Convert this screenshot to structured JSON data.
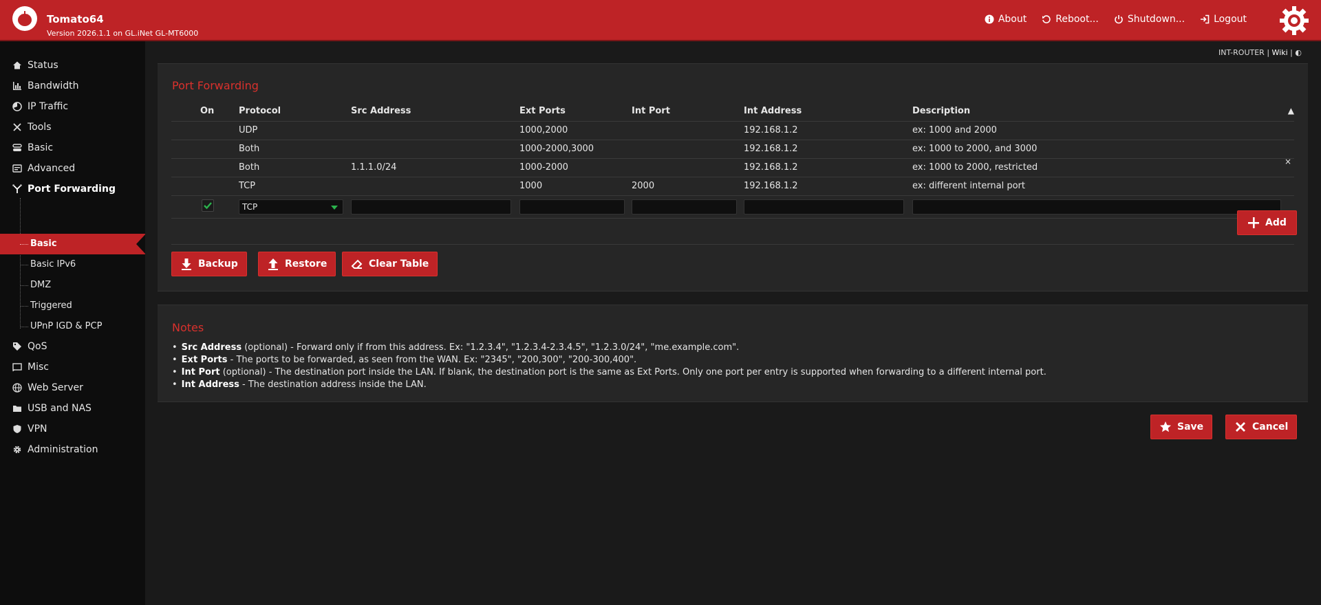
{
  "header": {
    "app_title": "Tomato64",
    "version": "Version 2026.1.1 on GL.iNet GL-MT6000",
    "nav": [
      {
        "label": "About",
        "icon": "info-icon"
      },
      {
        "label": "Reboot...",
        "icon": "reboot-icon"
      },
      {
        "label": "Shutdown...",
        "icon": "power-icon"
      },
      {
        "label": "Logout",
        "icon": "logout-icon"
      }
    ]
  },
  "sidebar": {
    "items": [
      {
        "label": "Status",
        "icon": "home-icon"
      },
      {
        "label": "Bandwidth",
        "icon": "bar-chart-icon"
      },
      {
        "label": "IP Traffic",
        "icon": "pie-icon"
      },
      {
        "label": "Tools",
        "icon": "tools-icon"
      },
      {
        "label": "Basic",
        "icon": "toggle-icon"
      },
      {
        "label": "Advanced",
        "icon": "sliders-icon"
      },
      {
        "label": "Port Forwarding",
        "icon": "fork-icon"
      },
      {
        "label": "QoS",
        "icon": "tag-icon"
      },
      {
        "label": "Misc",
        "icon": "cast-icon"
      },
      {
        "label": "Web Server",
        "icon": "globe-icon"
      },
      {
        "label": "USB and NAS",
        "icon": "folder-icon"
      },
      {
        "label": "VPN",
        "icon": "shield-icon"
      },
      {
        "label": "Administration",
        "icon": "gear-icon"
      }
    ],
    "sub_items": [
      "Basic",
      "Basic IPv6",
      "DMZ",
      "Triggered",
      "UPnP IGD & PCP"
    ],
    "active_sub": "Basic"
  },
  "crumb": {
    "router": "INT-ROUTER",
    "sep": "|",
    "wiki": "Wiki",
    "toggle": "◐"
  },
  "port_forwarding": {
    "title": "Port Forwarding",
    "columns": [
      "On",
      "Protocol",
      "Src Address",
      "Ext Ports",
      "Int Port",
      "Int Address",
      "Description"
    ],
    "rows": [
      {
        "on": "",
        "protocol": "UDP",
        "src": "",
        "ext": "1000,2000",
        "int_port": "",
        "int_addr": "192.168.1.2",
        "desc": "ex: 1000 and 2000"
      },
      {
        "on": "",
        "protocol": "Both",
        "src": "",
        "ext": "1000-2000,3000",
        "int_port": "",
        "int_addr": "192.168.1.2",
        "desc": "ex: 1000 to 2000, and 3000"
      },
      {
        "on": "",
        "protocol": "Both",
        "src": "1.1.1.0/24",
        "ext": "1000-2000",
        "int_port": "",
        "int_addr": "192.168.1.2",
        "desc": "ex: 1000 to 2000, restricted"
      },
      {
        "on": "",
        "protocol": "TCP",
        "src": "",
        "ext": "1000",
        "int_port": "2000",
        "int_addr": "192.168.1.2",
        "desc": "ex: different internal port"
      }
    ],
    "new_row": {
      "protocol": "TCP",
      "on": true
    },
    "add_label": "Add",
    "row_delete": "×",
    "sort_indicator": "▲"
  },
  "actions": {
    "backup": "Backup",
    "restore": "Restore",
    "clear": "Clear Table"
  },
  "notes": {
    "title": "Notes",
    "items": [
      {
        "term": "Src Address",
        "text": " (optional) - Forward only if from this address. Ex: \"1.2.3.4\", \"1.2.3.4-2.3.4.5\", \"1.2.3.0/24\", \"me.example.com\"."
      },
      {
        "term": "Ext Ports",
        "text": " - The ports to be forwarded, as seen from the WAN. Ex: \"2345\", \"200,300\", \"200-300,400\"."
      },
      {
        "term": "Int Port",
        "text": " (optional) - The destination port inside the LAN. If blank, the destination port is the same as Ext Ports. Only one port per entry is supported when forwarding to a different internal port."
      },
      {
        "term": "Int Address",
        "text": " - The destination address inside the LAN."
      }
    ]
  },
  "footer": {
    "save": "Save",
    "cancel": "Cancel"
  },
  "colors": {
    "accent": "#be2326",
    "accent_text": "#d9312d",
    "panel": "#262626",
    "check": "#2bb24c"
  }
}
